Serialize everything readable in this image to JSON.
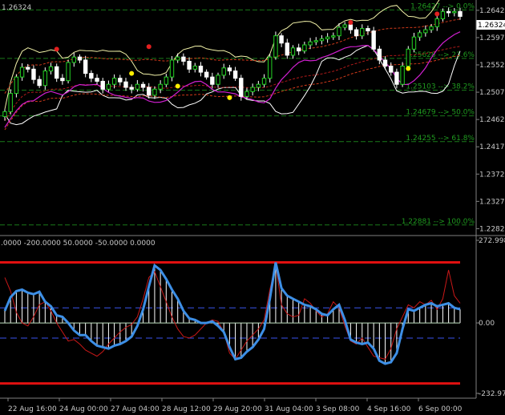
{
  "symbol_label": "1.26324",
  "oscillator_label": ".0000 -200.0000 50.0000 -50.0000 0.0000",
  "current_price_label": "1.26324",
  "chart_data": [
    {
      "type": "candlestick",
      "title": "",
      "price_ticks": [
        "1.26420",
        "1.25970",
        "1.25520",
        "1.25070",
        "1.24620",
        "1.24170",
        "1.23720",
        "1.23270",
        "1.22820"
      ],
      "ylim": [
        1.2272,
        1.2659
      ],
      "fibonacci_levels": [
        {
          "label": "1.26427 --> 0.0%",
          "price": 1.26427
        },
        {
          "label": "1.25628 --> 23.6%",
          "price": 1.25628
        },
        {
          "label": "1.25103 --> 38.2%",
          "price": 1.25103
        },
        {
          "label": "1.24679 --> 50.0%",
          "price": 1.24679
        },
        {
          "label": "1.24255 --> 61.8%",
          "price": 1.24255
        },
        {
          "label": "1.22881 --> 100.0%",
          "price": 1.22881
        }
      ],
      "close": [
        1.2475,
        1.2505,
        1.2532,
        1.2548,
        1.2545,
        1.2528,
        1.2518,
        1.2542,
        1.2549,
        1.253,
        1.2526,
        1.2556,
        1.2565,
        1.256,
        1.2538,
        1.253,
        1.2525,
        1.2512,
        1.252,
        1.253,
        1.2524,
        1.2515,
        1.2512,
        1.252,
        1.2515,
        1.2502,
        1.2512,
        1.252,
        1.2532,
        1.256,
        1.2565,
        1.2558,
        1.2545,
        1.255,
        1.254,
        1.2532,
        1.252,
        1.2535,
        1.2547,
        1.2542,
        1.253,
        1.25,
        1.2508,
        1.2515,
        1.252,
        1.253,
        1.2565,
        1.26,
        1.2588,
        1.2568,
        1.258,
        1.2575,
        1.2585,
        1.259,
        1.2592,
        1.2595,
        1.2598,
        1.26,
        1.2614,
        1.2618,
        1.261,
        1.26,
        1.2612,
        1.2608,
        1.2578,
        1.256,
        1.255,
        1.254,
        1.252,
        1.255,
        1.2578,
        1.2598,
        1.2605,
        1.261,
        1.2615,
        1.2628,
        1.264,
        1.2638,
        1.264,
        1.2632
      ],
      "upper_fractals": [
        {
          "i": 9,
          "price": 1.2578
        },
        {
          "i": 25,
          "price": 1.2582
        },
        {
          "i": 60,
          "price": 1.2622
        },
        {
          "i": 75,
          "price": 1.2636
        }
      ],
      "lower_fractals": [
        {
          "i": 22,
          "price": 1.2538
        },
        {
          "i": 30,
          "price": 1.2517
        },
        {
          "i": 39,
          "price": 1.2498
        },
        {
          "i": 70,
          "price": 1.2546
        }
      ]
    },
    {
      "type": "line",
      "title": "",
      "ylim": [
        -232.9,
        272.99
      ],
      "y_ticks": [
        "272.998",
        "0.00",
        "-232.97"
      ],
      "x_ticks": [
        "22 Aug 16:00",
        "24 Aug 00:00",
        "27 Aug 04:00",
        "28 Aug 12:00",
        "29 Aug 20:00",
        "31 Aug 04:00",
        "3 Sep 08:00",
        "4 Sep 16:00",
        "6 Sep 00:00"
      ],
      "levels": [
        {
          "value": 200,
          "color": "#e01010"
        },
        {
          "value": -200,
          "color": "#e01010"
        },
        {
          "value": 50,
          "color": "#3a55ee"
        },
        {
          "value": -50,
          "color": "#3a55ee"
        }
      ],
      "series": [
        {
          "role": "main",
          "color": "#3d8fe6",
          "values": [
            40,
            85,
            105,
            110,
            100,
            95,
            103,
            70,
            55,
            25,
            20,
            0,
            -25,
            -40,
            -40,
            -60,
            -75,
            -80,
            -85,
            -75,
            -70,
            -60,
            -45,
            -10,
            45,
            120,
            190,
            175,
            145,
            110,
            80,
            40,
            15,
            10,
            0,
            0,
            5,
            -10,
            -30,
            -80,
            -120,
            -115,
            -95,
            -80,
            -55,
            -20,
            80,
            200,
            115,
            90,
            80,
            70,
            60,
            55,
            45,
            30,
            25,
            45,
            60,
            10,
            -55,
            -65,
            -70,
            -65,
            -85,
            -125,
            -135,
            -130,
            -100,
            -20,
            45,
            40,
            50,
            60,
            65,
            55,
            60,
            65,
            50,
            45
          ]
        },
        {
          "role": "signal",
          "color": "#c81818",
          "values": [
            150,
            105,
            35,
            0,
            -10,
            20,
            60,
            70,
            40,
            0,
            -30,
            -60,
            -55,
            -70,
            -90,
            -100,
            -110,
            -95,
            -70,
            -50,
            -30,
            -15,
            -5,
            20,
            80,
            150,
            170,
            120,
            70,
            20,
            -20,
            -45,
            -50,
            -40,
            -20,
            0,
            10,
            5,
            -30,
            -100,
            -120,
            -90,
            -60,
            -40,
            -20,
            10,
            110,
            195,
            60,
            30,
            20,
            25,
            80,
            65,
            40,
            20,
            30,
            70,
            50,
            -10,
            -60,
            -70,
            -50,
            -80,
            -110,
            -115,
            -120,
            -85,
            -20,
            20,
            60,
            50,
            70,
            60,
            75,
            45,
            80,
            175,
            90,
            65
          ]
        }
      ]
    }
  ]
}
